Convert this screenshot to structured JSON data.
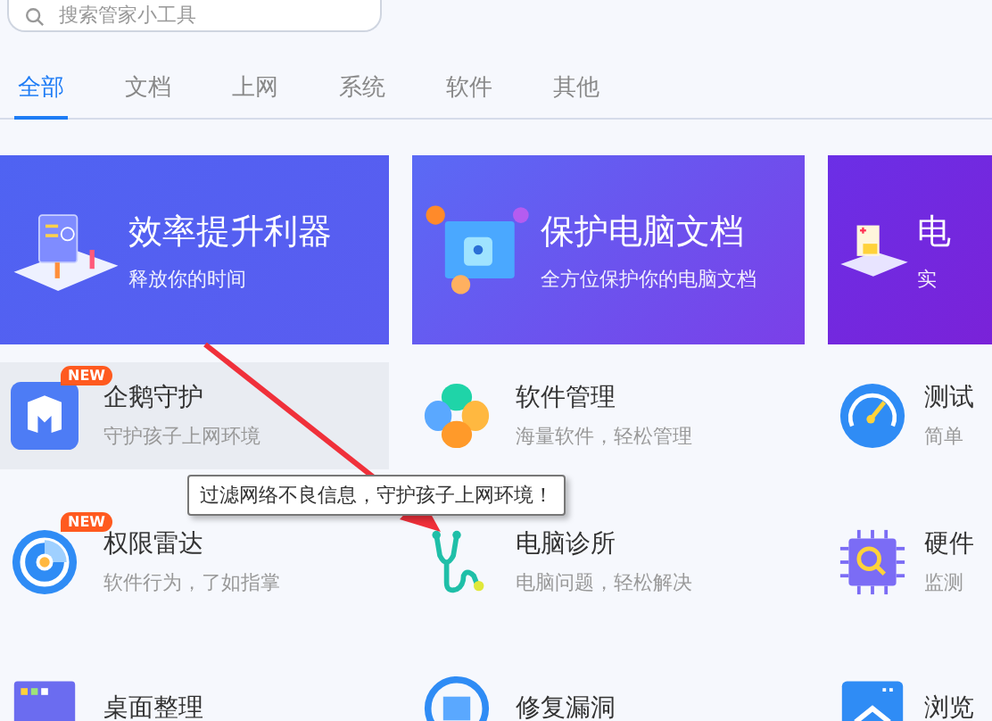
{
  "search": {
    "placeholder": "搜索管家小工具"
  },
  "tabs": [
    {
      "label": "全部",
      "selected": true
    },
    {
      "label": "文档",
      "selected": false
    },
    {
      "label": "上网",
      "selected": false
    },
    {
      "label": "系统",
      "selected": false
    },
    {
      "label": "软件",
      "selected": false
    },
    {
      "label": "其他",
      "selected": false
    }
  ],
  "banners": [
    {
      "kind": "efficiency",
      "title": "效率提升利器",
      "subtitle": "释放你的时间"
    },
    {
      "kind": "documents",
      "title": "保护电脑文档",
      "subtitle": "全方位保护你的电脑文档"
    },
    {
      "kind": "medical",
      "title": "电",
      "subtitle": "实"
    }
  ],
  "tools": [
    {
      "kind": "shield",
      "name": "企鹅守护",
      "description": "守护孩子上网环境",
      "badge": "NEW",
      "hovered": true
    },
    {
      "kind": "clover",
      "name": "软件管理",
      "description": "海量软件，轻松管理",
      "hovered": false
    },
    {
      "kind": "gauge",
      "name": "测试",
      "description": "简单",
      "hovered": false
    },
    {
      "kind": "radar",
      "name": "权限雷达",
      "description": "软件行为，了如指掌",
      "badge": "NEW",
      "hovered": false
    },
    {
      "kind": "stethoscope",
      "name": "电脑诊所",
      "description": "电脑问题，轻松解决",
      "hovered": false
    },
    {
      "kind": "chip",
      "name": "硬件",
      "description": "监测",
      "hovered": false
    },
    {
      "kind": "desktop",
      "name": "桌面整理",
      "hovered": false
    },
    {
      "kind": "repair",
      "name": "修复漏洞",
      "hovered": false
    },
    {
      "kind": "browser",
      "name": "浏览",
      "hovered": false
    }
  ],
  "tooltip": "过滤网络不良信息，守护孩子上网环境！"
}
